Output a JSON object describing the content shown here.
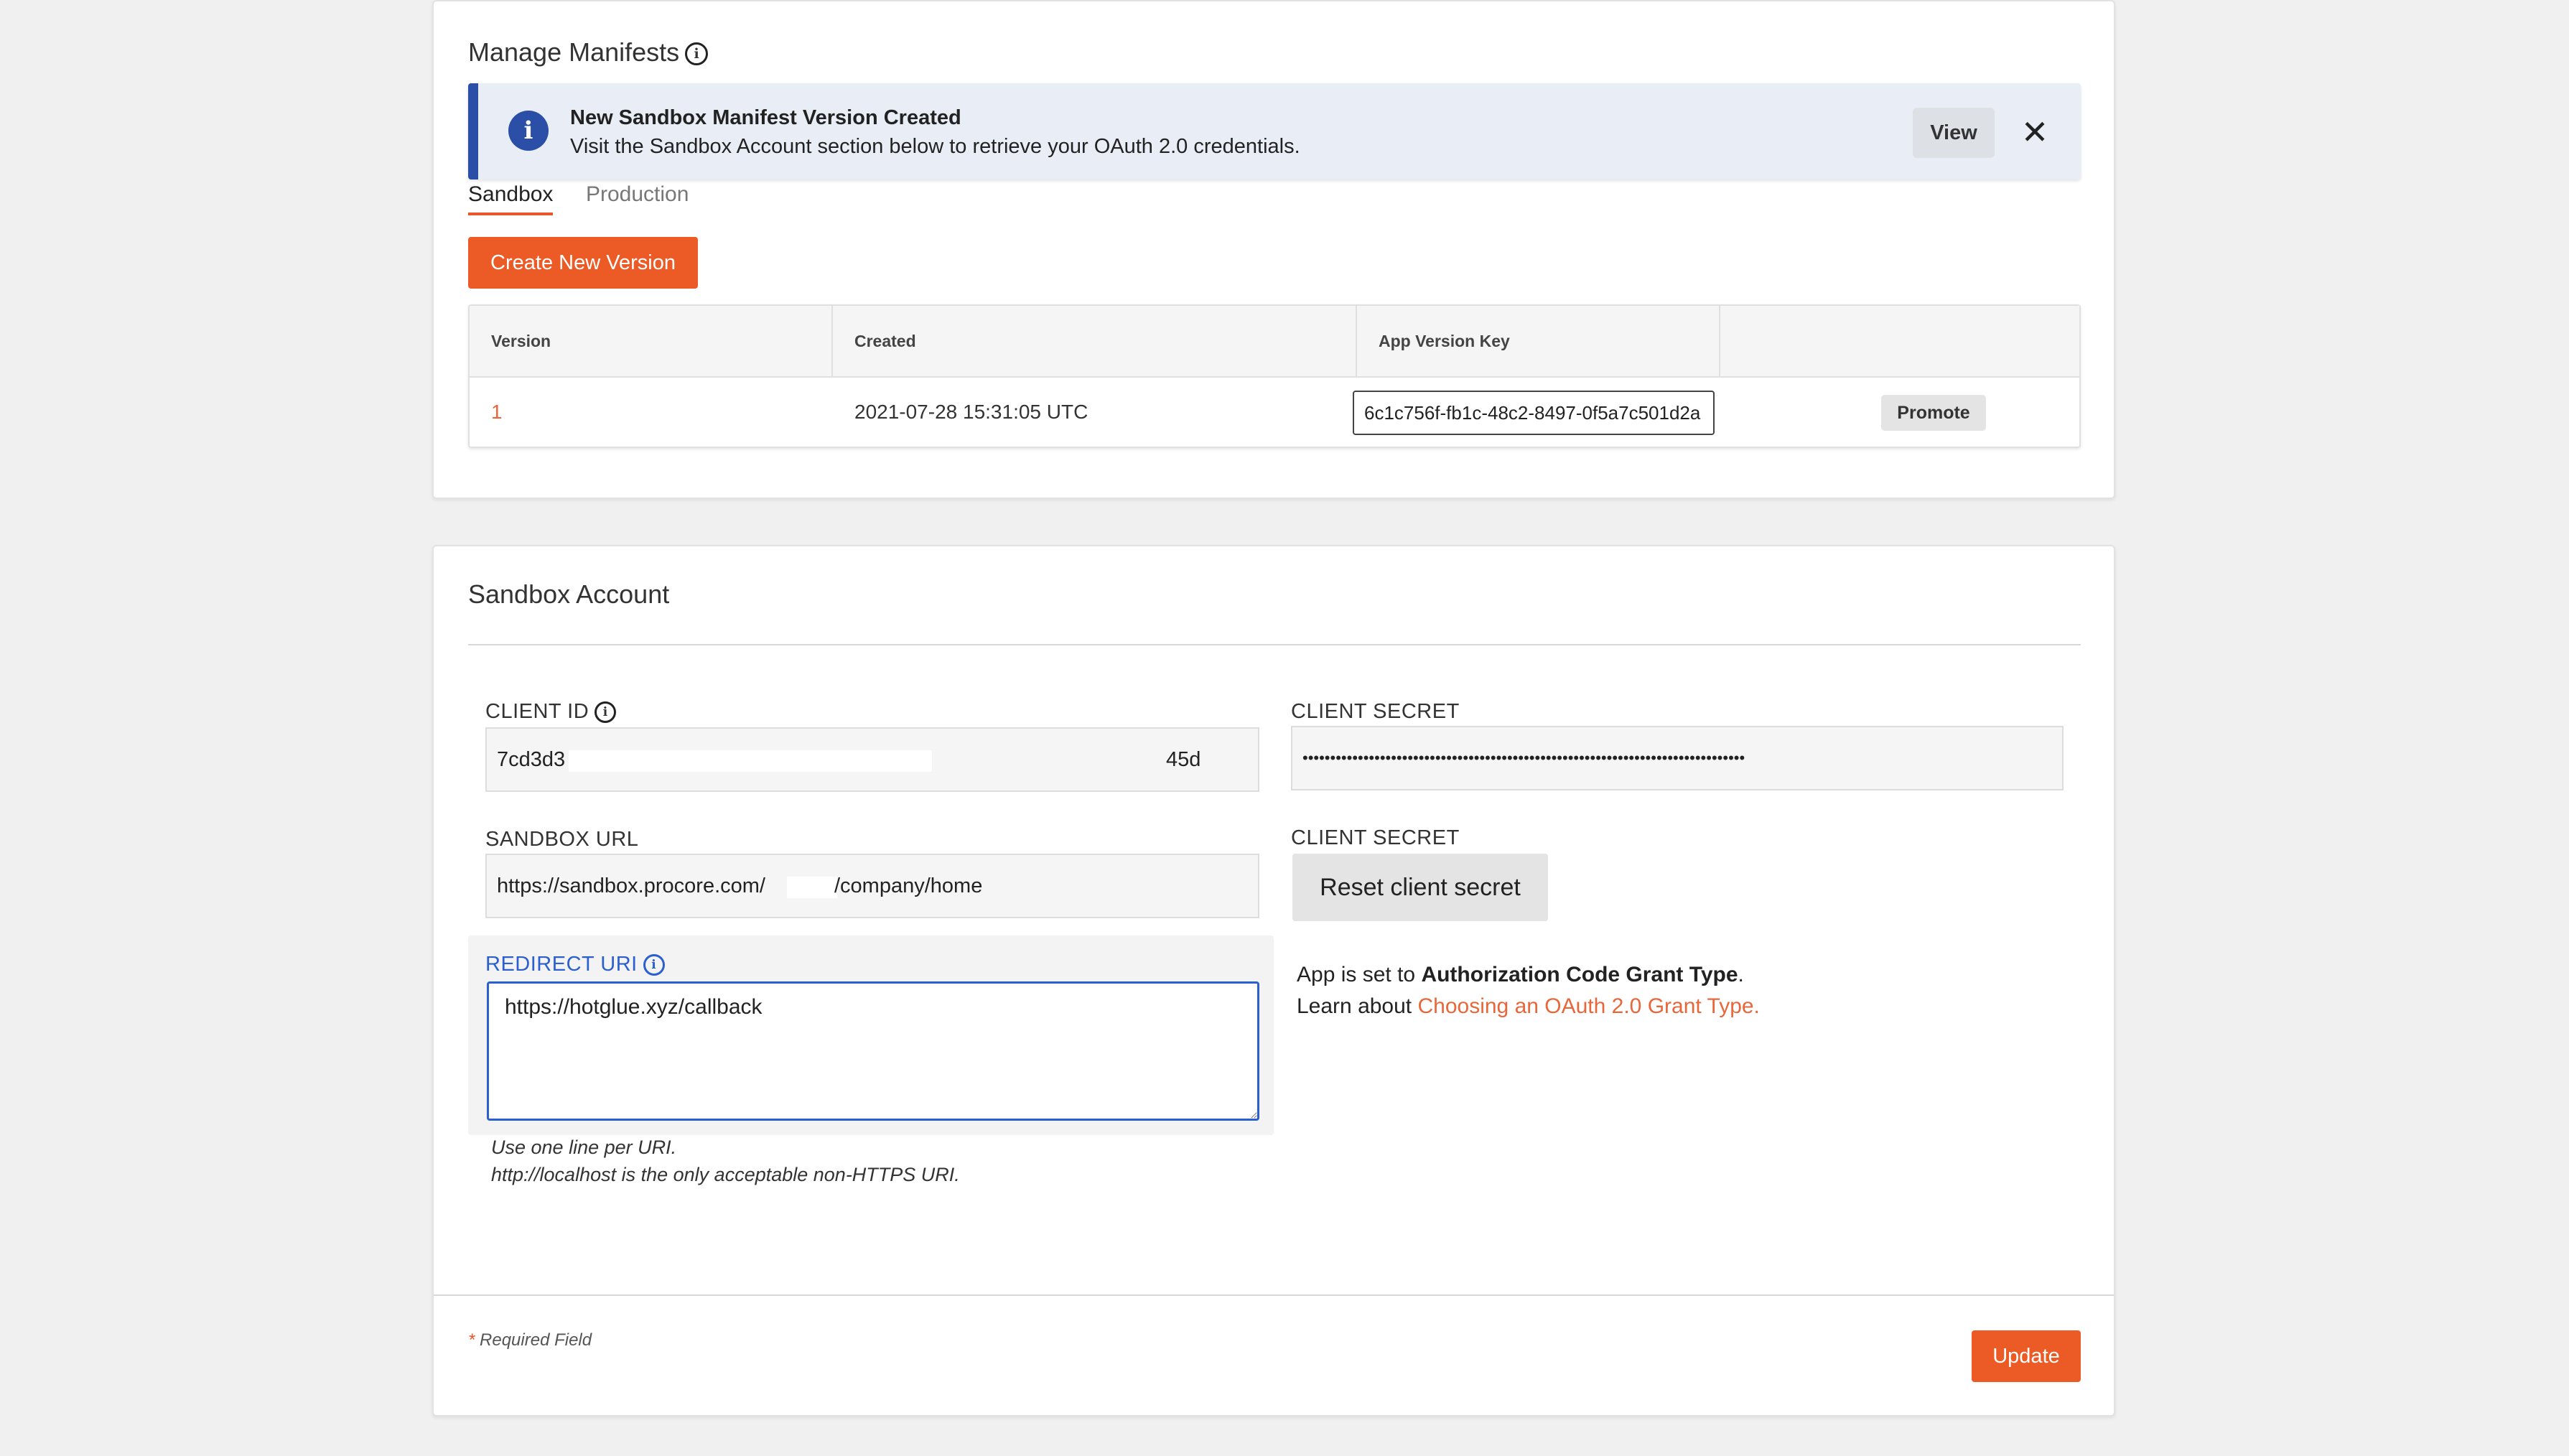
{
  "manifests": {
    "title": "Manage Manifests",
    "banner": {
      "title": "New Sandbox Manifest Version Created",
      "text": "Visit the Sandbox Account section below to retrieve your OAuth 2.0 credentials.",
      "view_label": "View",
      "close_glyph": "✕"
    },
    "tabs": [
      {
        "label": "Sandbox",
        "active": true
      },
      {
        "label": "Production",
        "active": false
      }
    ],
    "create_label": "Create New Version",
    "table": {
      "headers": [
        "Version",
        "Created",
        "App Version Key",
        ""
      ],
      "rows": [
        {
          "version": "1",
          "created": "2021-07-28 15:31:05 UTC",
          "key": "6c1c756f-fb1c-48c2-8497-0f5a7c501d2a",
          "action": "Promote"
        }
      ]
    }
  },
  "sandbox": {
    "title": "Sandbox Account",
    "client_id": {
      "label": "CLIENT ID",
      "prefix": "7cd3d3",
      "suffix": "45d"
    },
    "client_secret": {
      "label": "CLIENT SECRET",
      "value": "••••••••••••••••••••••••••••••••••••••••••••••••••••••••••••••••••••••••••••••••"
    },
    "sandbox_url": {
      "label": "SANDBOX URL",
      "prefix": "https://sandbox.procore.com/",
      "suffix": "/company/home"
    },
    "client_secret_reset": {
      "label": "CLIENT SECRET",
      "button": "Reset client secret"
    },
    "redirect_uri": {
      "label": "REDIRECT URI",
      "value": "https://hotglue.xyz/callback"
    },
    "hints": [
      "Use one line per URI.",
      "http://localhost is the only acceptable non-HTTPS URI."
    ],
    "grant": {
      "line1_prefix": "App is set to ",
      "line1_bold": "Authorization Code Grant Type",
      "line1_suffix": ".",
      "line2_prefix": "Learn about ",
      "line2_link": "Choosing an OAuth 2.0 Grant Type."
    },
    "required_star": "*",
    "required_label": "Required Field",
    "update_label": "Update"
  },
  "colors": {
    "accent": "#ec5b26",
    "info_blue": "#2b4fa6",
    "focus_blue": "#2b5fd0",
    "link": "#e8673a"
  },
  "icons": {
    "info": "info-icon",
    "banner": "info-circle-icon",
    "close": "close-icon"
  }
}
